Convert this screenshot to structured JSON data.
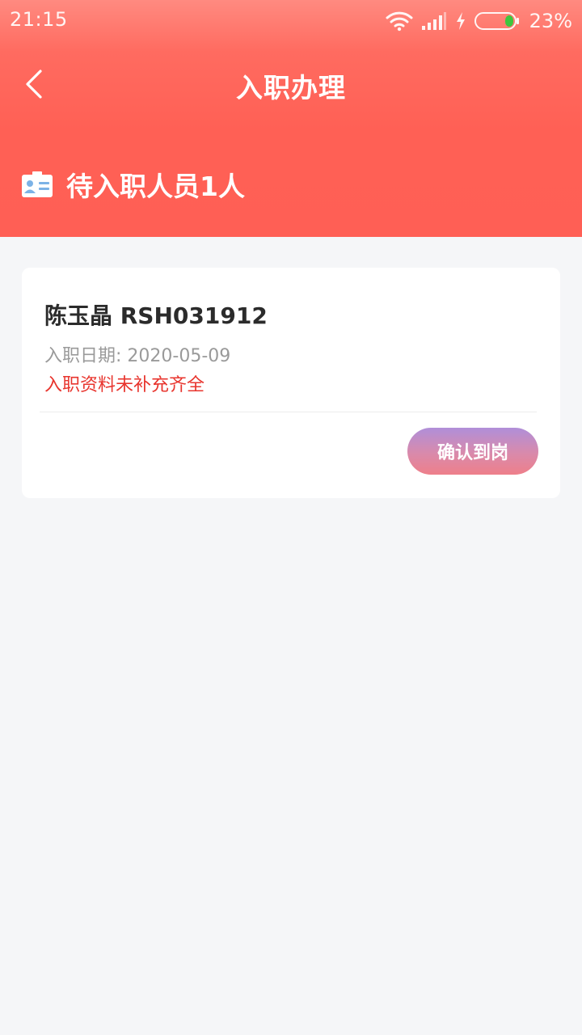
{
  "status_bar": {
    "time": "21:15",
    "battery_percent": "23%",
    "battery_level": 0.23
  },
  "nav": {
    "title": "入职办理"
  },
  "summary": {
    "text": "待入职人员1人"
  },
  "colors": {
    "header_gradient_top": "#ff8a80",
    "header_gradient_bottom": "#ff5f55",
    "warning": "#e8352e",
    "button_gradient_top": "#b08fd9",
    "button_gradient_bottom": "#ee7f8a"
  },
  "icons": {
    "back": "chevron-left-icon",
    "id_card": "id-card-icon",
    "wifi": "wifi-icon",
    "signal": "signal-icon",
    "charging": "charging-icon",
    "battery": "battery-icon"
  },
  "employees": [
    {
      "name_id": "陈玉晶 RSH031912",
      "hire_date": "入职日期: 2020-05-09",
      "warning": "入职资料未补充齐全",
      "action_label": "确认到岗"
    }
  ]
}
